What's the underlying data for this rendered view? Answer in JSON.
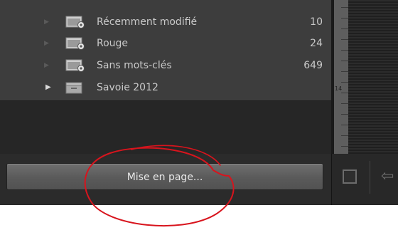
{
  "collections": [
    {
      "label": "Récemment modifié",
      "count": "10",
      "expandable": false
    },
    {
      "label": "Rouge",
      "count": "24",
      "expandable": false
    },
    {
      "label": "Sans mots-clés",
      "count": "649",
      "expandable": false
    },
    {
      "label": "Savoie 2012",
      "count": "",
      "expandable": true
    }
  ],
  "button": {
    "page_setup_label": "Mise en page..."
  },
  "ruler": {
    "marker": "14"
  },
  "icons": {
    "smart_collection": "smart-collection-folder-icon",
    "collection_set": "collection-set-icon",
    "expand": "triangle-right-icon",
    "checkbox": "checkbox-icon",
    "nav": "arrow-left-icon"
  },
  "colors": {
    "panel": "#3d3d3d",
    "text": "#c9c9c9",
    "button": "#5f5f5f",
    "annotation": "#d8141d"
  }
}
